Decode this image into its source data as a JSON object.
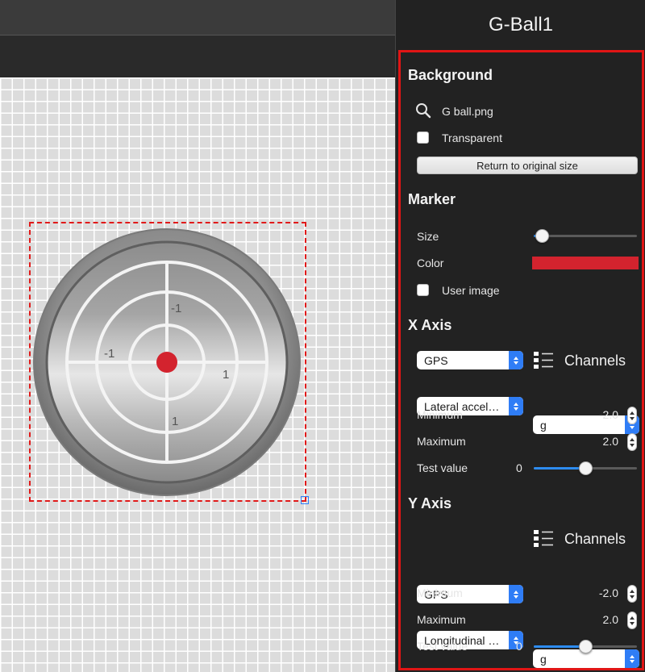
{
  "inspector": {
    "title": "G-Ball1",
    "background": {
      "heading": "Background",
      "file_name": "G ball.png",
      "transparent_label": "Transparent",
      "return_button": "Return to original size"
    },
    "marker": {
      "heading": "Marker",
      "size_label": "Size",
      "size_value": 0.08,
      "color_label": "Color",
      "color": "#d3232e",
      "user_image_label": "User image"
    },
    "x_axis": {
      "heading": "X Axis",
      "source": "GPS",
      "channels_label": "Channels",
      "channel": "Lateral acceleration",
      "unit": "g",
      "minimum_label": "Minimum",
      "minimum": "-2.0",
      "maximum_label": "Maximum",
      "maximum": "2.0",
      "test_label": "Test value",
      "test_value": "0",
      "test_slider_fraction": 0.5
    },
    "y_axis": {
      "heading": "Y Axis",
      "source": "GPS",
      "channels_label": "Channels",
      "channel": "Longitudinal acceleration",
      "unit": "g",
      "minimum_label": "Minimum",
      "minimum": "-2.0",
      "maximum_label": "Maximum",
      "maximum": "2.0",
      "test_label": "Test value",
      "test_value": "0",
      "test_slider_fraction": 0.5
    }
  },
  "gball": {
    "ring_labels": {
      "top": "-1",
      "left": "-1",
      "right": "1",
      "bottom": "1"
    },
    "marker_color": "#d3232e"
  },
  "colors": {
    "accent": "#2f7df6",
    "selection": "#e11a1a"
  }
}
